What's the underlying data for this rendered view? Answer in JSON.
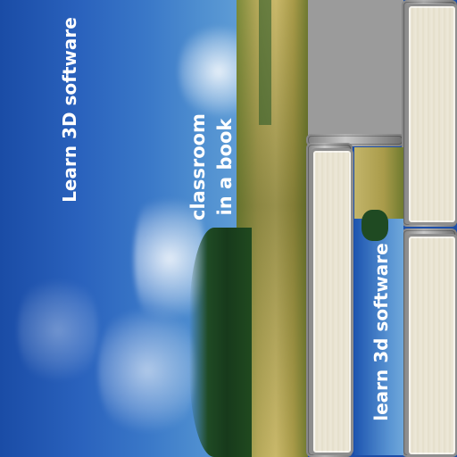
{
  "labels": {
    "left": "Learn 3D software",
    "center": "classroom\nin a book",
    "thumbnail": "learn 3d software"
  },
  "colors": {
    "sky": "#2a62bd",
    "field": "#c2b163",
    "paper": "#e9e4d3",
    "metal": "#9b9b9b",
    "text": "#ffffff"
  }
}
